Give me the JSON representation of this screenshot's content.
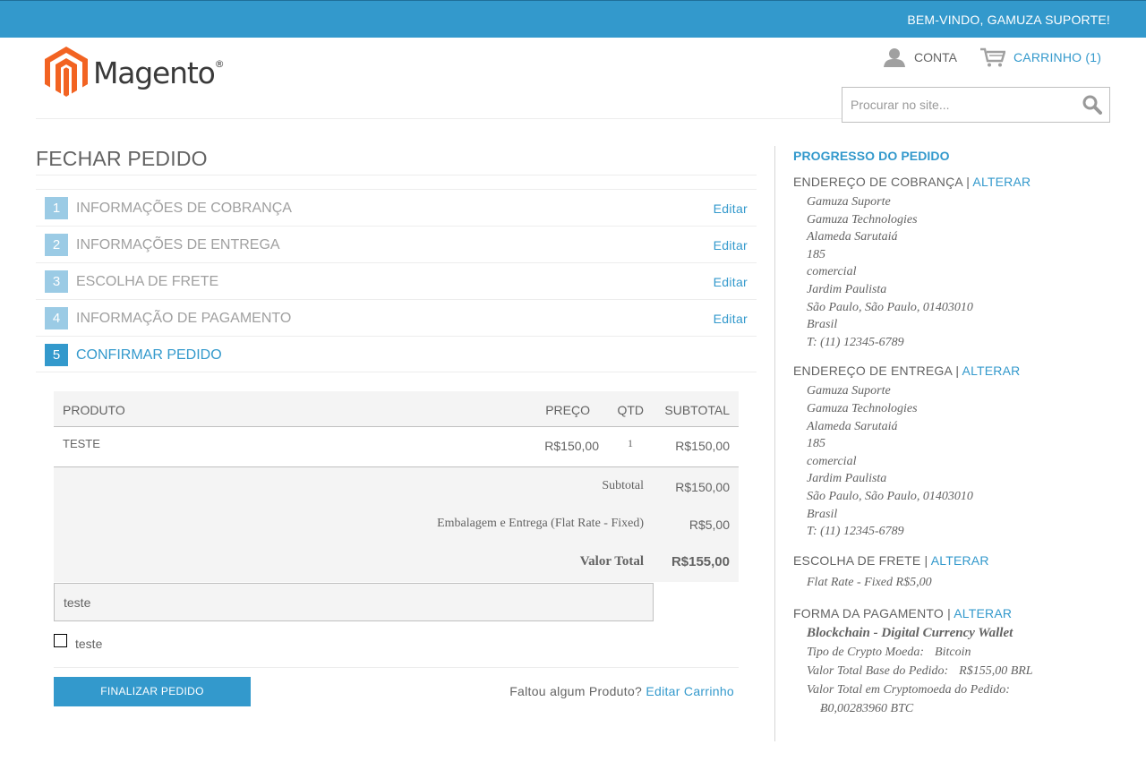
{
  "header": {
    "welcome": "BEM-VINDO, GAMUZA SUPORTE!",
    "logo_text": "Magento",
    "logo_reg": "®",
    "account_label": "CONTA",
    "cart_label": "CARRINHO (1)",
    "search_placeholder": "Procurar no site..."
  },
  "page": {
    "title": "FECHAR PEDIDO"
  },
  "steps": [
    {
      "num": "1",
      "title": "INFORMAÇÕES DE COBRANÇA",
      "edit": "Editar"
    },
    {
      "num": "2",
      "title": "INFORMAÇÕES DE ENTREGA",
      "edit": "Editar"
    },
    {
      "num": "3",
      "title": "ESCOLHA DE FRETE",
      "edit": "Editar"
    },
    {
      "num": "4",
      "title": "INFORMAÇÃO DE PAGAMENTO",
      "edit": "Editar"
    },
    {
      "num": "5",
      "title": "CONFIRMAR PEDIDO"
    }
  ],
  "review": {
    "columns": {
      "product": "PRODUTO",
      "price": "PREÇO",
      "qty": "QTD",
      "subtotal": "SUBTOTAL"
    },
    "items": [
      {
        "name": "TESTE",
        "price": "R$150,00",
        "qty": "1",
        "subtotal": "R$150,00"
      }
    ],
    "totals": {
      "subtotal_label": "Subtotal",
      "subtotal_value": "R$150,00",
      "shipping_label": "Embalagem e Entrega (Flat Rate - Fixed)",
      "shipping_value": "R$5,00",
      "grand_label": "Valor Total",
      "grand_value": "R$155,00"
    },
    "comment": "teste",
    "agreement_label": "teste",
    "submit_label": "FINALIZAR PEDIDO",
    "forgot_text": "Faltou algum Produto?",
    "edit_cart": "Editar Carrinho"
  },
  "sidebar": {
    "title": "PROGRESSO DO PEDIDO",
    "billing": {
      "heading": "ENDEREÇO DE COBRANÇA",
      "change": "ALTERAR",
      "lines": [
        "Gamuza Suporte",
        "Gamuza Technologies",
        "Alameda Sarutaiá",
        "185",
        "comercial",
        "Jardim Paulista",
        "São Paulo, São Paulo, 01403010",
        "Brasil",
        "T: (11) 12345-6789"
      ]
    },
    "shipping": {
      "heading": "ENDEREÇO DE ENTREGA",
      "change": "ALTERAR",
      "lines": [
        "Gamuza Suporte",
        "Gamuza Technologies",
        "Alameda Sarutaiá",
        "185",
        "comercial",
        "Jardim Paulista",
        "São Paulo, São Paulo, 01403010",
        "Brasil",
        "T: (11) 12345-6789"
      ]
    },
    "method": {
      "heading": "ESCOLHA DE FRETE",
      "change": "ALTERAR",
      "text": "Flat Rate - Fixed R$5,00"
    },
    "payment": {
      "heading": "FORMA DA PAGAMENTO",
      "change": "ALTERAR",
      "name": "Blockchain - Digital Currency Wallet",
      "crypto_label": "Tipo de Crypto Moeda:",
      "crypto_value": "Bitcoin",
      "base_label": "Valor Total Base do Pedido:",
      "base_value": "R$155,00 BRL",
      "crypto_total_label": "Valor Total em Cryptomoeda do Pedido:",
      "crypto_total_value": "Ƀ0,00283960 BTC"
    }
  },
  "colors": {
    "accent": "#3399cc",
    "text": "#636363",
    "logo_orange": "#f26322"
  }
}
